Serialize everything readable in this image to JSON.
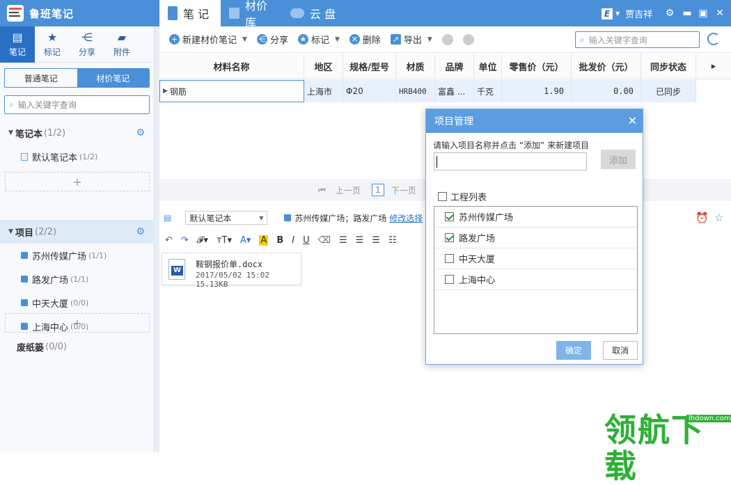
{
  "app": {
    "title": "鲁班笔记"
  },
  "main_tabs": [
    {
      "label": "笔 记"
    },
    {
      "label": "材价库"
    },
    {
      "label": "云 盘"
    }
  ],
  "user": {
    "badge": "E",
    "name": "贾吉祥"
  },
  "sidebar": {
    "nav": [
      {
        "label": "笔记"
      },
      {
        "label": "标记"
      },
      {
        "label": "分享"
      },
      {
        "label": "附件"
      }
    ],
    "seg": {
      "normal": "普通笔记",
      "price": "材价笔记"
    },
    "search_placeholder": "输入关键字查询",
    "notebooks": {
      "label": "笔记本",
      "count": "(1/2)",
      "items": [
        {
          "label": "默认笔记本",
          "count": "(1/2)"
        }
      ]
    },
    "projects": {
      "label": "项目",
      "count": "(2/2)",
      "items": [
        {
          "label": "苏州传媒广场",
          "count": "(1/1)"
        },
        {
          "label": "路发广场",
          "count": "(1/1)"
        },
        {
          "label": "中天大厦",
          "count": "(0/0)"
        },
        {
          "label": "上海中心",
          "count": "(0/0)"
        }
      ]
    },
    "add_symbol": "+",
    "trash": {
      "label": "废纸篓",
      "count": "(0/0)"
    }
  },
  "toolbar": {
    "new": "新建材价笔记",
    "share": "分享",
    "mark": "标记",
    "delete": "删除",
    "export": "导出",
    "search_placeholder": "输入关键字查询"
  },
  "grid": {
    "headers": [
      "材料名称",
      "地区",
      "规格/型号",
      "材质",
      "品牌",
      "单位",
      "零售价（元）",
      "批发价（元）",
      "同步状态"
    ],
    "row": {
      "name": "钢筋",
      "region": "上海市",
      "spec": "Φ20",
      "material": "HRB400",
      "brand": "富鑫 ...",
      "unit": "千克",
      "retail": "1.90",
      "wholesale": "0.00",
      "sync": "已同步"
    }
  },
  "pager": {
    "prev": "上一页",
    "page": "1",
    "next": "下一页"
  },
  "editor": {
    "notebook": "默认笔记本",
    "projects_text": "苏州传媒广场；路发广场",
    "modify": "修改选择"
  },
  "attachment": {
    "name": "鞍钢报价单.docx",
    "meta": "2017/05/02 15:02 15.13KB",
    "icon_letter": "W"
  },
  "dialog": {
    "title": "项目管理",
    "prompt": "请输入项目名称并点击 “添加” 来新建项目",
    "add": "添加",
    "list_label": "工程列表",
    "items": [
      {
        "label": "苏州传媒广场",
        "checked": true
      },
      {
        "label": "路发广场",
        "checked": true
      },
      {
        "label": "中天大厦",
        "checked": false
      },
      {
        "label": "上海中心",
        "checked": false
      }
    ],
    "ok": "确定",
    "cancel": "取消"
  },
  "watermark": {
    "text": "领航下载",
    "site": "lhdown.com"
  }
}
